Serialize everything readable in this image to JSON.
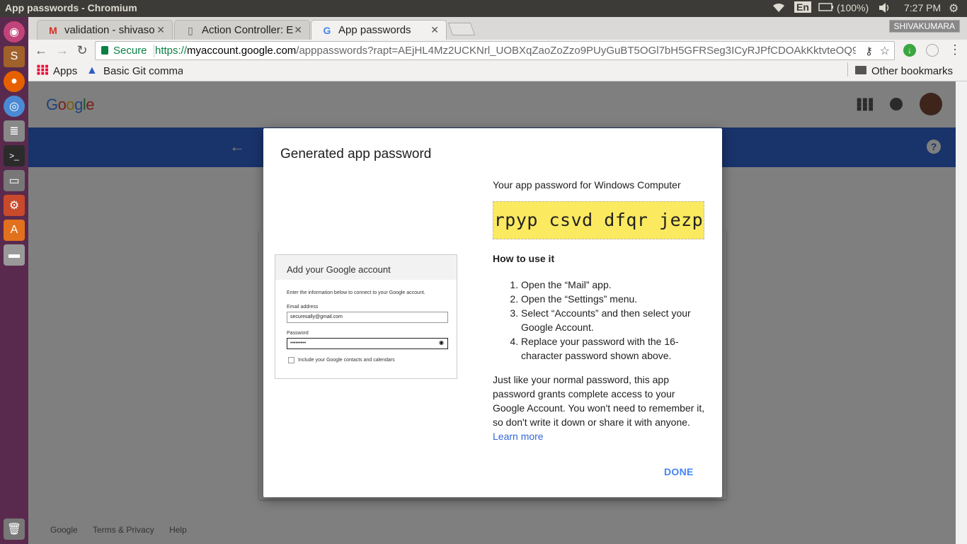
{
  "window": {
    "title": "App passwords - Chromium"
  },
  "system": {
    "keyboard": "En",
    "battery": "(100%)",
    "clock": "7:27 PM"
  },
  "tabs": [
    {
      "label": "validation - shivaso",
      "icon": "gmail-icon"
    },
    {
      "label": "Action Controller: E",
      "icon": "document-icon"
    },
    {
      "label": "App passwords",
      "icon": "google-icon"
    }
  ],
  "user_badge": "SHIVAKUMARA",
  "omnibox": {
    "secure_label": "Secure",
    "url_scheme": "https://",
    "url_host": "myaccount.google.com",
    "url_path": "/apppasswords?rapt=AEjHL4Mz2UCKNrl_UOBXqZaoZoZzo9PUyGuBT5OGl7bH5GFRSeg3ICyRJPfCDOAkKktvteOQ9EjR8PtP…"
  },
  "bookmarks": {
    "apps": "Apps",
    "git": "Basic Git comma",
    "other": "Other bookmarks"
  },
  "google_logo": "Google",
  "dialog": {
    "title": "Generated app password",
    "mock": {
      "heading": "Add your Google account",
      "desc": "Enter the information below to connect to your Google account.",
      "email_label": "Email address",
      "email_value": "securesally@gmail.com",
      "password_label": "Password",
      "password_value": "•••••••••",
      "checkbox_label": "Include your Google contacts and calendars"
    },
    "pw_for": "Your app password for Windows Computer",
    "password": "rpyp csvd dfqr jezp",
    "howto_heading": "How to use it",
    "steps": [
      "Open the “Mail” app.",
      "Open the “Settings” menu.",
      "Select “Accounts” and then select your Google Account.",
      "Replace your password with the 16-character password shown above."
    ],
    "note": "Just like your normal password, this app password grants complete access to your Google Account. You won't need to remember it, so don't write it down or share it with anyone.",
    "learn_more": "Learn more",
    "done": "DONE"
  },
  "footer": {
    "google": "Google",
    "terms": "Terms & Privacy",
    "help": "Help"
  },
  "colors": {
    "brand_blue": "#3367d6",
    "password_bg": "#fbe960",
    "launcher": "#5a2a4e"
  }
}
